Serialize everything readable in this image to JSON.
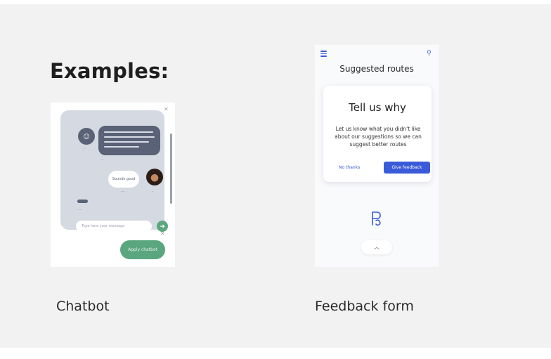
{
  "heading": "Examples:",
  "examples": [
    {
      "caption": "Chatbot",
      "chat": {
        "user_message": "Sounds good",
        "input_placeholder": "Type here your message",
        "cta_label": "Apply chatbot"
      }
    },
    {
      "caption": "Feedback form",
      "feedback": {
        "screen_title": "Suggested routes",
        "modal_title": "Tell us why",
        "modal_body": "Let us know what you didn't like about our suggestions so we can suggest better routes",
        "no_thanks_label": "No thanks",
        "give_feedback_label": "Give feedback"
      }
    }
  ],
  "icons": {
    "menu": "menu-icon",
    "search": "search-icon",
    "send": "send-icon",
    "chevron_up": "chevron-up-icon",
    "logo": "logo-icon"
  },
  "colors": {
    "chat_accent": "#5a6277",
    "chat_cta": "#5aa67e",
    "feedback_accent": "#3a5bd9"
  }
}
